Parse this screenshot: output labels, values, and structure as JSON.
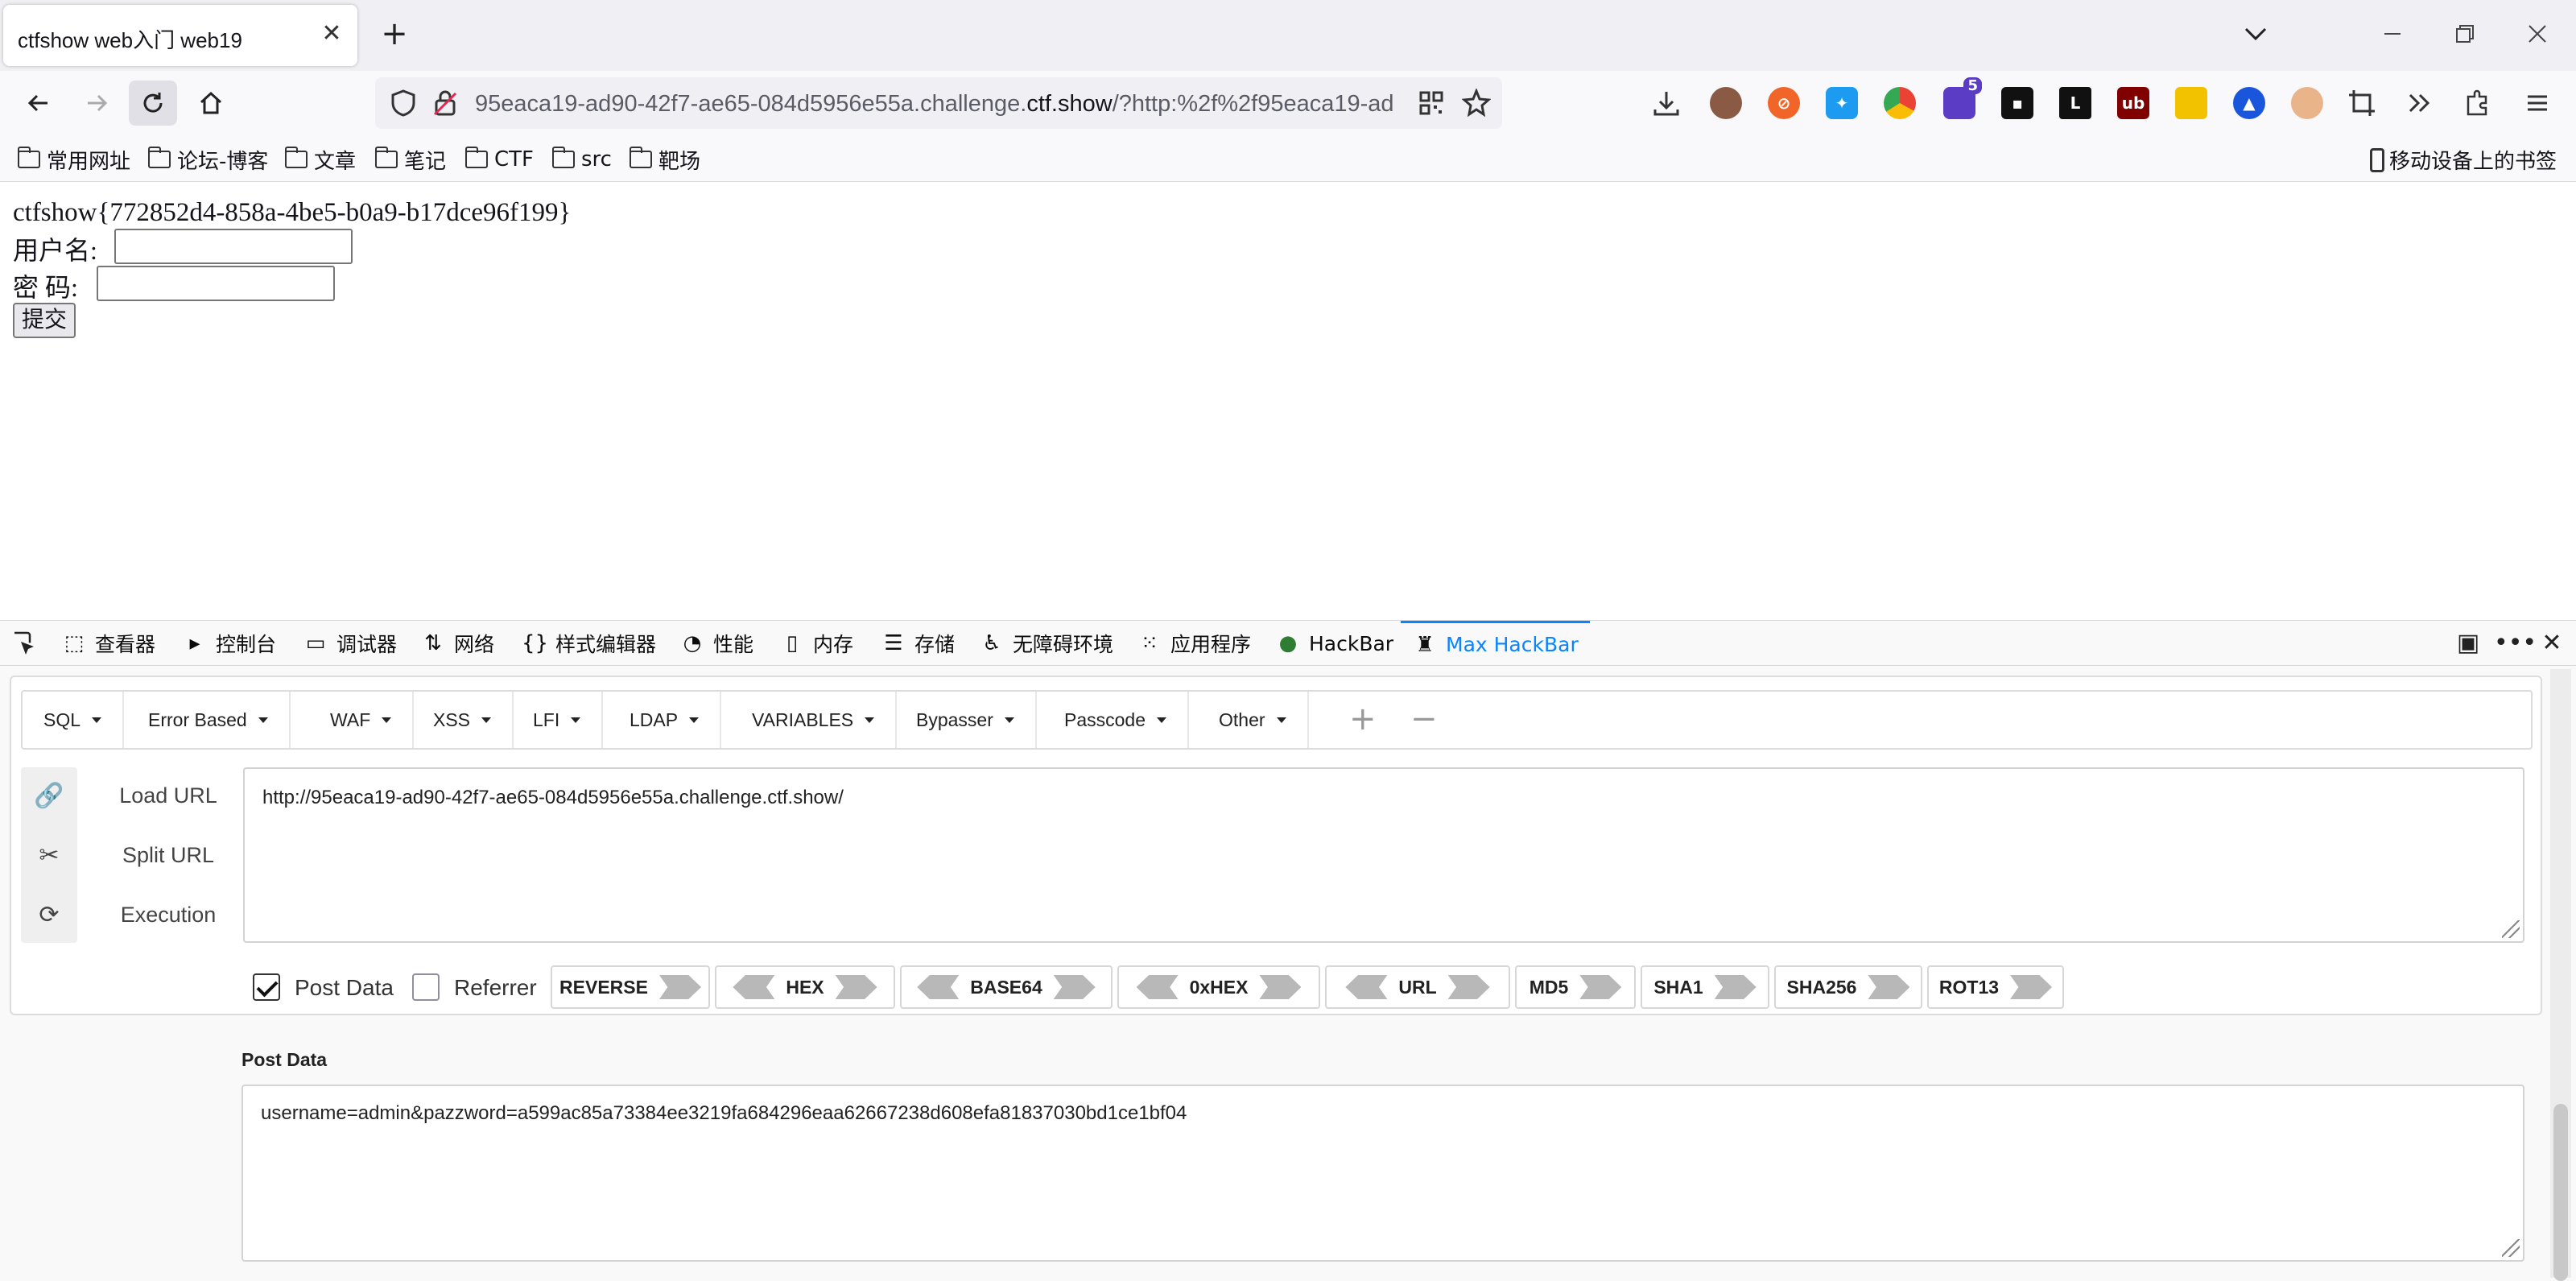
{
  "browser": {
    "tab_title": "ctfshow web入门 web19",
    "url_prefix": "95eaca19-ad90-42f7-ae65-084d5956e55a.challenge.",
    "url_domain": "ctf.show",
    "url_suffix": "/?http:%2f%2f95eaca19-ad",
    "bookmarks": [
      "常用网址",
      "论坛-博客",
      "文章",
      "笔记",
      "CTF",
      "src",
      "靶场"
    ],
    "mobile_bookmarks": "移动设备上的书签",
    "extension_badge": "5"
  },
  "page": {
    "flag": "ctfshow{772852d4-858a-4be5-b0a9-b17dce96f199}",
    "username_label": "用户名:",
    "password_label": "密 码:",
    "username_value": "",
    "password_value": "",
    "submit_label": "提交"
  },
  "devtools": {
    "tabs": [
      {
        "label": "查看器",
        "icon": "inspector-icon"
      },
      {
        "label": "控制台",
        "icon": "console-icon"
      },
      {
        "label": "调试器",
        "icon": "debugger-icon"
      },
      {
        "label": "网络",
        "icon": "network-icon"
      },
      {
        "label": "样式编辑器",
        "icon": "style-editor-icon"
      },
      {
        "label": "性能",
        "icon": "performance-icon"
      },
      {
        "label": "内存",
        "icon": "memory-icon"
      },
      {
        "label": "存储",
        "icon": "storage-icon"
      },
      {
        "label": "无障碍环境",
        "icon": "accessibility-icon"
      },
      {
        "label": "应用程序",
        "icon": "application-icon"
      },
      {
        "label": "HackBar",
        "icon": "hackbar-icon"
      },
      {
        "label": "Max HackBar",
        "icon": "max-hackbar-icon"
      }
    ],
    "active_tab": "Max HackBar"
  },
  "hackbar": {
    "menus": [
      "SQL",
      "Error Based",
      "WAF",
      "XSS",
      "LFI",
      "LDAP",
      "VARIABLES",
      "Bypasser",
      "Passcode",
      "Other"
    ],
    "actions": [
      "Load URL",
      "Split URL",
      "Execution"
    ],
    "url_value": "http://95eaca19-ad90-42f7-ae65-084d5956e55a.challenge.ctf.show/",
    "post_data_checked": true,
    "post_data_label": "Post Data",
    "referrer_checked": false,
    "referrer_label": "Referrer",
    "encoders": [
      "REVERSE",
      "HEX",
      "BASE64",
      "0xHEX",
      "URL",
      "MD5",
      "SHA1",
      "SHA256",
      "ROT13"
    ],
    "post_title": "Post Data",
    "post_value": "username=admin&pazzword=a599ac85a73384ee3219fa684296eaa62667238d608efa81837030bd1ce1bf04"
  },
  "colors": {
    "accent": "#0a84ff",
    "tabstrip_bg": "#f0f0f4",
    "toolbar_bg": "#f9f9fb"
  }
}
